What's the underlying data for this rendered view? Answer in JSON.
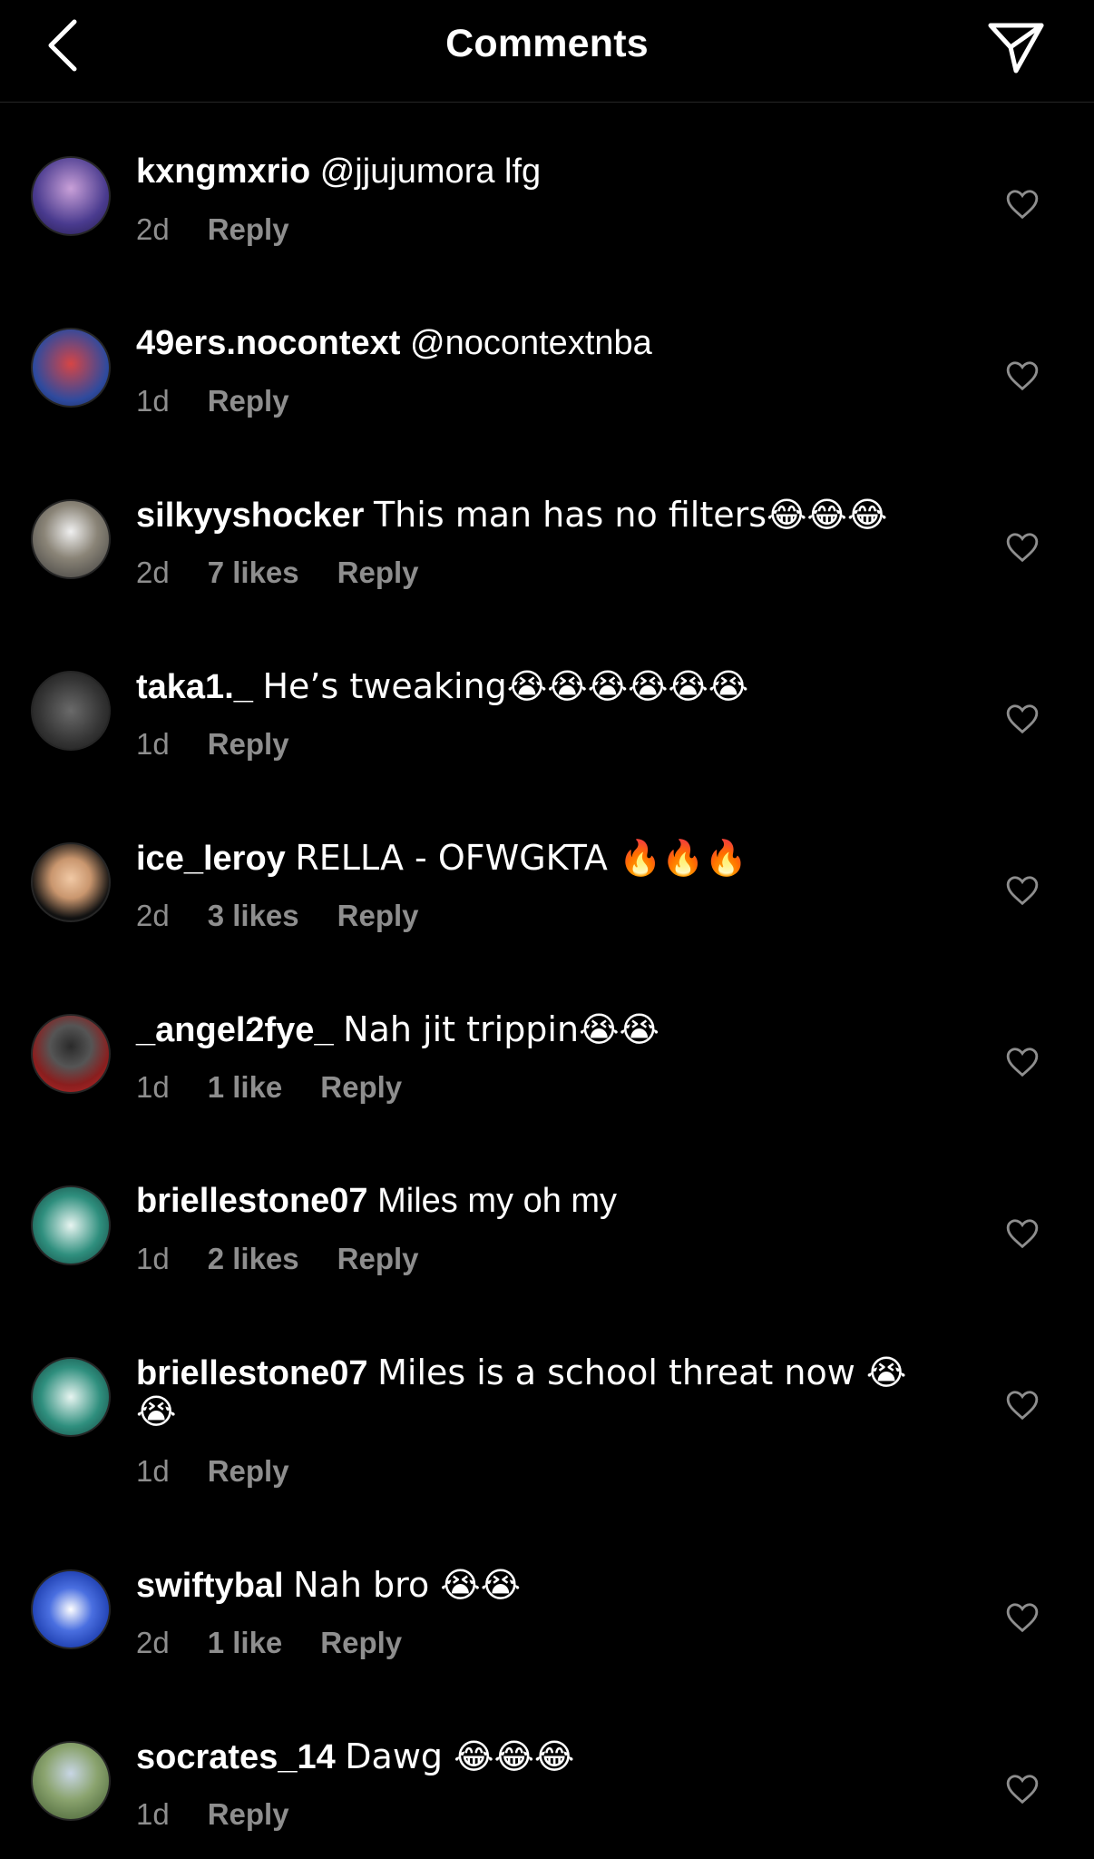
{
  "header": {
    "title": "Comments",
    "back_icon": "chevron-left-icon",
    "send_icon": "paper-plane-icon"
  },
  "comments": [
    {
      "username": "kxngmxrio",
      "text": "@jjujumora lfg",
      "time": "2d",
      "likes": "",
      "reply": "Reply",
      "avatar_color": "#4a3b8f"
    },
    {
      "username": "49ers.nocontext",
      "text": "@nocontextnba",
      "time": "1d",
      "likes": "",
      "reply": "Reply",
      "avatar_color": "#2e4a9e"
    },
    {
      "username": "silkyyshocker",
      "text": "This man has no filters😂😂😂",
      "time": "2d",
      "likes": "7 likes",
      "reply": "Reply",
      "avatar_color": "#6e6a60"
    },
    {
      "username": "taka1._",
      "text": "He’s tweaking😭😭😭😭😭😭",
      "time": "1d",
      "likes": "",
      "reply": "Reply",
      "avatar_color": "#333333"
    },
    {
      "username": "ice_leroy",
      "text": "RELLA - OFWGKTA 🔥🔥🔥",
      "time": "2d",
      "likes": "3 likes",
      "reply": "Reply",
      "avatar_color": "#111111"
    },
    {
      "username": "_angel2fye_",
      "text": "Nah jit trippin😭😭",
      "time": "1d",
      "likes": "1 like",
      "reply": "Reply",
      "avatar_color": "#8a1e1e"
    },
    {
      "username": "briellestone07",
      "text": "Miles my oh my",
      "time": "1d",
      "likes": "2 likes",
      "reply": "Reply",
      "avatar_color": "#2f8f7e"
    },
    {
      "username": "briellestone07",
      "text": "Miles is a school threat now 😭😭",
      "time": "1d",
      "likes": "",
      "reply": "Reply",
      "avatar_color": "#2f8f7e"
    },
    {
      "username": "swiftybal",
      "text": "Nah bro 😭😭",
      "time": "2d",
      "likes": "1 like",
      "reply": "Reply",
      "avatar_color": "#1e3fb0"
    },
    {
      "username": "socrates_14",
      "text": "Dawg 😂😂😂",
      "time": "1d",
      "likes": "",
      "reply": "Reply",
      "avatar_color": "#5c7a4a"
    }
  ],
  "icons": {
    "like": "heart-icon"
  }
}
